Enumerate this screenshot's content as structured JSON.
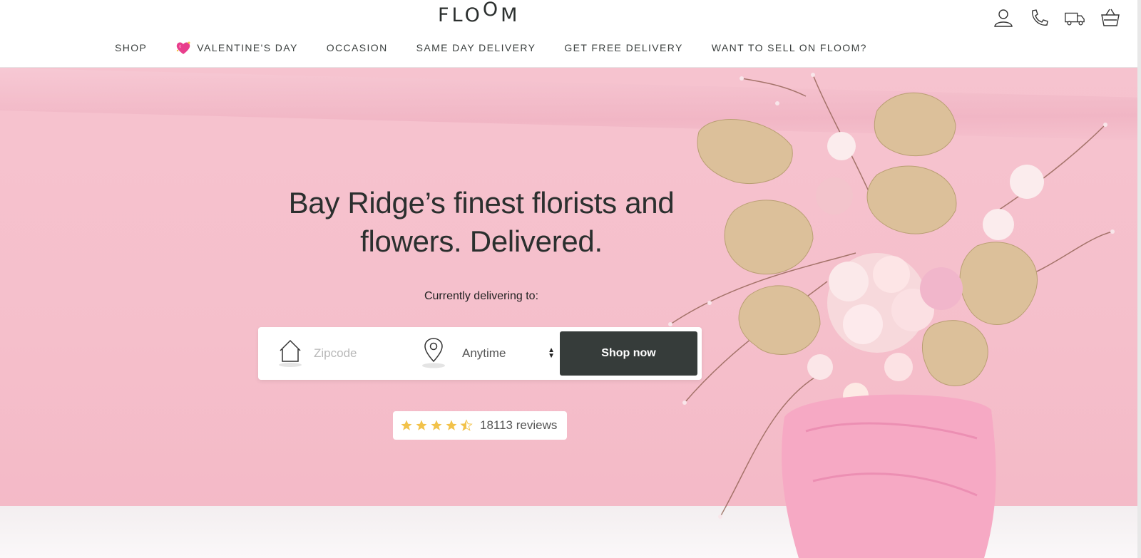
{
  "brand": {
    "logo": "FLOOM"
  },
  "header_icons": [
    "user-icon",
    "phone-icon",
    "delivery-truck-icon",
    "basket-icon"
  ],
  "nav": {
    "items": [
      {
        "label": "SHOP"
      },
      {
        "label": "VALENTINE'S DAY",
        "icon": "sparkling-heart-icon"
      },
      {
        "label": "OCCASION"
      },
      {
        "label": "SAME DAY DELIVERY"
      },
      {
        "label": "GET FREE DELIVERY"
      },
      {
        "label": "WANT TO SELL ON FLOOM?"
      }
    ]
  },
  "hero": {
    "headline_line1": "Bay Ridge’s finest florists and",
    "headline_line2": "flowers. Delivered.",
    "delivering_label": "Currently delivering to:",
    "zip_placeholder": "Zipcode",
    "time_value": "Anytime",
    "shop_button": "Shop now",
    "rating": 4.5,
    "reviews_text": "18113 reviews"
  },
  "colors": {
    "hero_bg": "#f5bfcb",
    "button_bg": "#363c3a",
    "star": "#f2c24a",
    "text_dark": "#2b2f2e"
  }
}
